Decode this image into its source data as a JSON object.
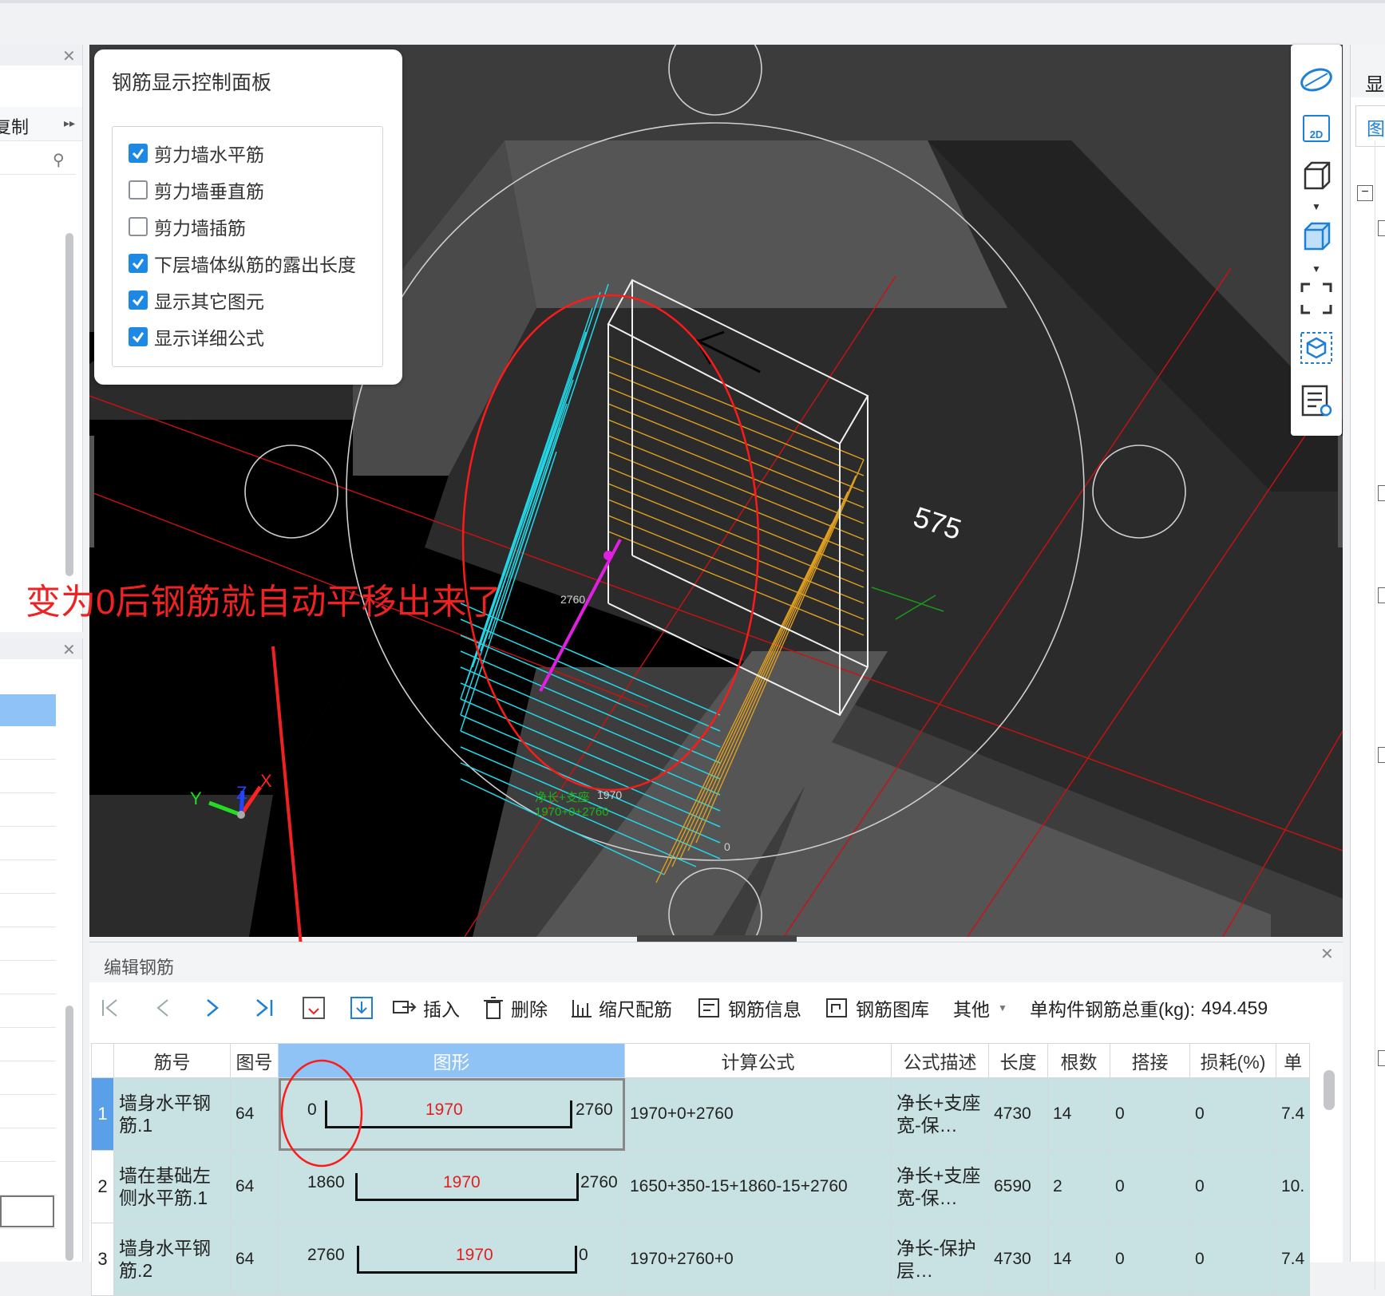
{
  "left_panel_top": {
    "label": "复制",
    "partial_label": "复制"
  },
  "control_panel": {
    "title": "钢筋显示控制面板",
    "options": [
      {
        "label": "剪力墙水平筋",
        "checked": true
      },
      {
        "label": "剪力墙垂直筋",
        "checked": false
      },
      {
        "label": "剪力墙插筋",
        "checked": false
      },
      {
        "label": "下层墙体纵筋的露出长度",
        "checked": true
      },
      {
        "label": "显示其它图元",
        "checked": true
      },
      {
        "label": "显示详细公式",
        "checked": true
      }
    ]
  },
  "viewport": {
    "dimension_label": "575",
    "rebar_label_2760": "2760",
    "formula_green_1": "净长+支座",
    "formula_green_2": "1970+0+2760",
    "small_label_1970": "1970",
    "small_label_0": "0",
    "axis_x": "X",
    "axis_y": "Y",
    "axis_z": "Z"
  },
  "annotation": {
    "text": "变为0后钢筋就自动平移出来了",
    "color": "#ee2222"
  },
  "right_toolbar": {
    "icons": [
      "orbit-icon",
      "2d-view-icon",
      "3d-box-icon",
      "solid-box-icon",
      "fit-view-icon",
      "view-cube-icon",
      "report-view-icon"
    ],
    "label_2d": "2D"
  },
  "right_panel": {
    "header": "显",
    "tab": "图"
  },
  "editor": {
    "title": "编辑钢筋",
    "toolbar": {
      "insert": "插入",
      "delete": "删除",
      "scale_rebar": "缩尺配筋",
      "rebar_info": "钢筋信息",
      "rebar_library": "钢筋图库",
      "other": "其他",
      "total_weight_label": "单构件钢筋总重(kg):",
      "total_weight_value": "494.459"
    },
    "columns": [
      "筋号",
      "图号",
      "图形",
      "计算公式",
      "公式描述",
      "长度",
      "根数",
      "搭接",
      "损耗(%)",
      "单"
    ],
    "rows": [
      {
        "index": "1",
        "name": "墙身水平钢筋.1",
        "fig": "64",
        "left": "0",
        "mid": "1970",
        "right": "2760",
        "formula": "1970+0+2760",
        "desc": "净长+支座宽-保…",
        "length": "4730",
        "count": "14",
        "lap": "0",
        "loss": "0",
        "unit": "7.4"
      },
      {
        "index": "2",
        "name": "墙在基础左侧水平筋.1",
        "fig": "64",
        "left": "1860",
        "mid": "1970",
        "right": "2760",
        "formula": "1650+350-15+1860-15+2760",
        "desc": "净长+支座宽-保…",
        "length": "6590",
        "count": "2",
        "lap": "0",
        "loss": "0",
        "unit": "10."
      },
      {
        "index": "3",
        "name": "墙身水平钢筋.2",
        "fig": "64",
        "left": "2760",
        "mid": "1970",
        "right": "0",
        "formula": "1970+2760+0",
        "desc": "净长-保护层…",
        "length": "4730",
        "count": "14",
        "lap": "0",
        "loss": "0",
        "unit": "7.4"
      }
    ]
  }
}
